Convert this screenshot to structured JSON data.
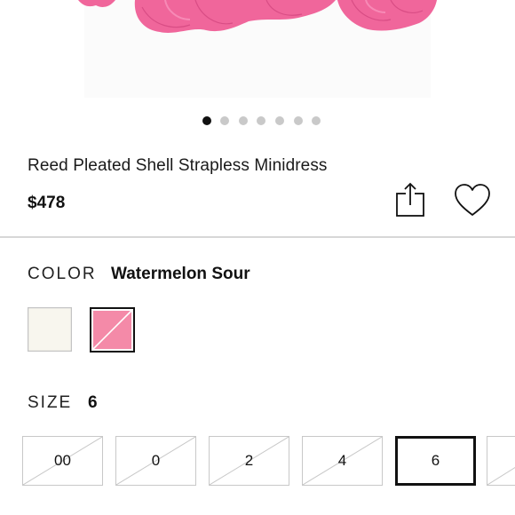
{
  "product": {
    "title": "Reed Pleated Shell Strapless Minidress",
    "price": "$478"
  },
  "carousel": {
    "count": 7,
    "active_index": 0
  },
  "actions": {
    "share_icon": "share-icon",
    "wishlist_icon": "heart-icon"
  },
  "color": {
    "label": "COLOR",
    "selected": "Watermelon Sour",
    "swatches": [
      {
        "hex": "#f8f6ee",
        "selected": false,
        "unavailable": false
      },
      {
        "hex": "#f48aa8",
        "selected": true,
        "unavailable": true
      }
    ]
  },
  "size": {
    "label": "SIZE",
    "selected": "6",
    "options": [
      {
        "label": "00",
        "unavailable": true,
        "selected": false
      },
      {
        "label": "0",
        "unavailable": true,
        "selected": false
      },
      {
        "label": "2",
        "unavailable": true,
        "selected": false
      },
      {
        "label": "4",
        "unavailable": true,
        "selected": false
      },
      {
        "label": "6",
        "unavailable": false,
        "selected": true
      }
    ]
  },
  "colors": {
    "dress_pink": "#f0669b",
    "accent": "#111111",
    "divider": "#d7d7d7"
  }
}
